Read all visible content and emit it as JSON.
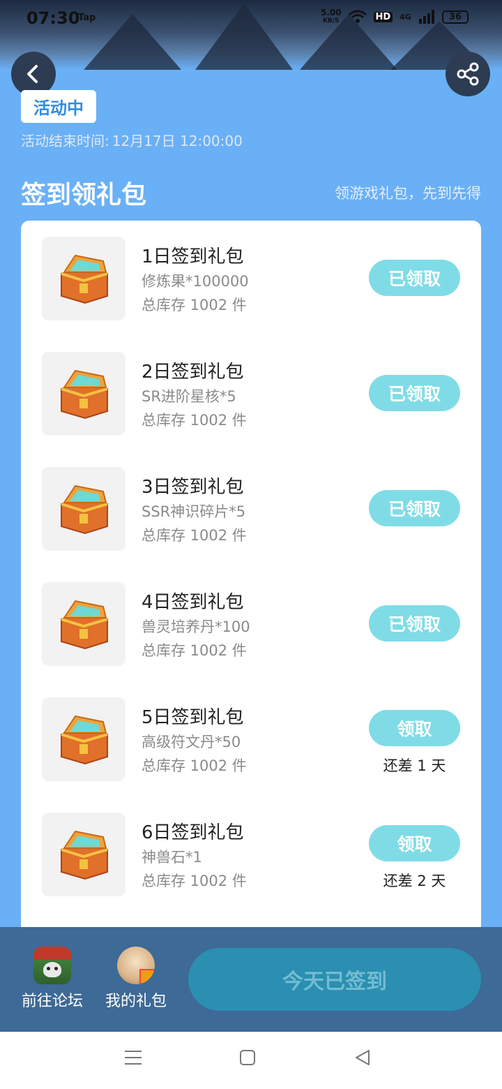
{
  "status_bar": {
    "time": "07:30",
    "carrier_tag": "Tap",
    "net_speed_value": "5.00",
    "net_speed_unit": "KB/S",
    "hd": "HD",
    "network": "4G",
    "battery": "36"
  },
  "header": {
    "status_badge": "活动中",
    "end_time_label": "活动结束时间:",
    "end_time_value": "12月17日 12:00:00"
  },
  "section": {
    "title": "签到领礼包",
    "subtitle": "领游戏礼包，先到先得"
  },
  "gifts": [
    {
      "title": "1日签到礼包",
      "item": "修炼果*100000",
      "stock": "总库存 1002 件",
      "button": "已领取",
      "remaining": ""
    },
    {
      "title": "2日签到礼包",
      "item": "SR进阶星核*5",
      "stock": "总库存 1002 件",
      "button": "已领取",
      "remaining": ""
    },
    {
      "title": "3日签到礼包",
      "item": "SSR神识碎片*5",
      "stock": "总库存 1002 件",
      "button": "已领取",
      "remaining": ""
    },
    {
      "title": "4日签到礼包",
      "item": "兽灵培养丹*100",
      "stock": "总库存 1002 件",
      "button": "已领取",
      "remaining": ""
    },
    {
      "title": "5日签到礼包",
      "item": "高级符文丹*50",
      "stock": "总库存 1002 件",
      "button": "领取",
      "remaining": "还差 1 天"
    },
    {
      "title": "6日签到礼包",
      "item": "神兽石*1",
      "stock": "总库存 1002 件",
      "button": "领取",
      "remaining": "还差 2 天"
    }
  ],
  "bottom_bar": {
    "forum_label": "前往论坛",
    "my_gifts_label": "我的礼包",
    "checkin_label": "今天已签到"
  },
  "colors": {
    "background": "#6ab0f6",
    "button": "#7fdce6",
    "bottom_bar": "#3d6a96",
    "checkin_button": "#2a8fb0"
  },
  "icons": [
    "back-arrow-icon",
    "share-icon",
    "treasure-chest-icon",
    "menu-icon",
    "home-icon",
    "back-triangle-icon"
  ]
}
